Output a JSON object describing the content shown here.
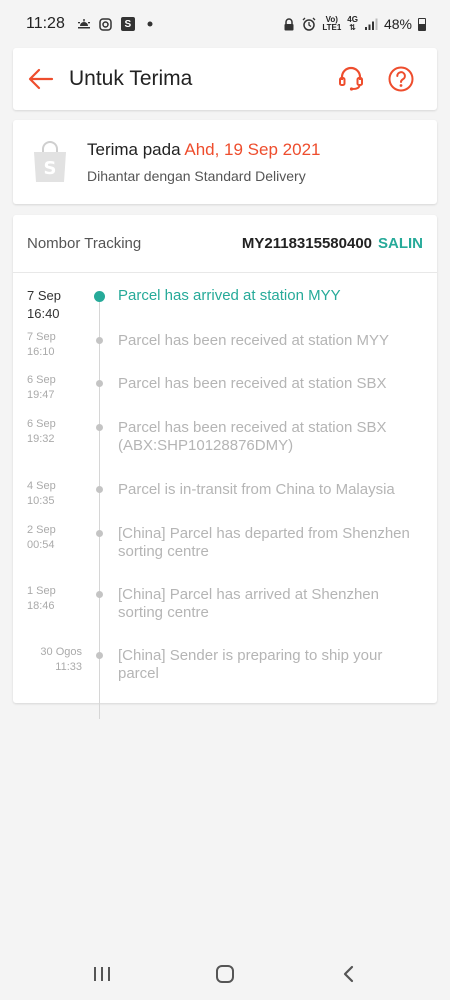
{
  "status_bar": {
    "time": "11:28",
    "network_top": "Vo)",
    "network_bottom": "LTE1",
    "net_type": "4G",
    "battery": "48%"
  },
  "header": {
    "title": "Untuk Terima",
    "icons": [
      "back-arrow-icon",
      "headset-icon",
      "help-icon"
    ],
    "accent_color": "#ee4d2d"
  },
  "receive": {
    "prefix": "Terima pada",
    "date": "Ahd, 19 Sep 2021",
    "delivery": "Dihantar dengan Standard Delivery"
  },
  "tracking": {
    "label": "Nombor Tracking",
    "number": "MY2118315580400",
    "copy_label": "SALIN",
    "accent_color": "#26aa99"
  },
  "events": [
    {
      "date": "7 Sep",
      "time": "16:40",
      "desc": "Parcel has arrived at station MYY",
      "active": true
    },
    {
      "date": "7 Sep",
      "time": "16:10",
      "desc": "Parcel has been received at station MYY",
      "active": false
    },
    {
      "date": "6 Sep",
      "time": "19:47",
      "desc": "Parcel has been received at station SBX",
      "active": false
    },
    {
      "date": "6 Sep",
      "time": "19:32",
      "desc": "Parcel has been received at station SBX (ABX:SHP10128876DMY)",
      "active": false
    },
    {
      "date": "4 Sep",
      "time": "10:35",
      "desc": "Parcel is in-transit from China to Malaysia",
      "active": false
    },
    {
      "date": "2 Sep",
      "time": "00:54",
      "desc": "[China] Parcel has departed from Shenzhen sorting centre",
      "active": false
    },
    {
      "date": "1 Sep",
      "time": "18:46",
      "desc": "[China] Parcel has arrived at Shenzhen sorting centre",
      "active": false
    },
    {
      "date": "30 Ogos",
      "time": "11:33",
      "desc": "[China] Sender is preparing to ship your parcel",
      "active": false
    }
  ]
}
